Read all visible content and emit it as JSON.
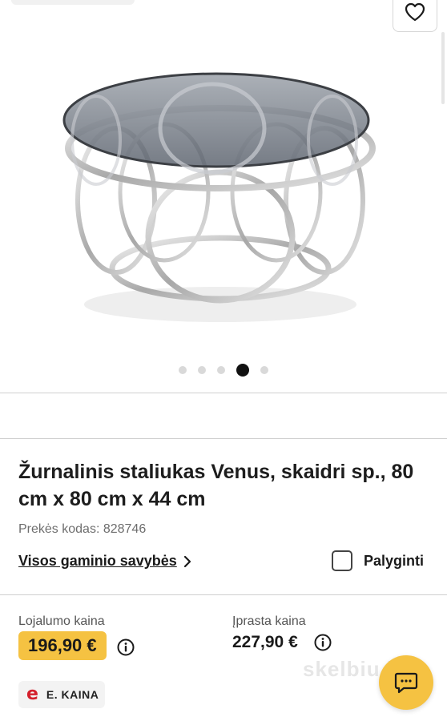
{
  "gallery": {
    "image_alt": "Žurnalinis staliukas Venus",
    "slide_count": 5,
    "active_slide": 4,
    "favorite_icon": "heart-icon"
  },
  "product": {
    "title": "Žurnalinis staliukas Venus, skaidri sp., 80 cm x 80 cm x 44 cm",
    "code": "Prekės kodas: 828746",
    "features_link": "Visos gaminio savybės",
    "compare_label": "Palyginti"
  },
  "pricing": {
    "loyalty_label": "Lojalumo kaina",
    "loyalty_price": "196,90 €",
    "regular_label": "Įprasta kaina",
    "regular_price": "227,90 €",
    "ekaina_logo": "e",
    "ekaina_label": "E. KAINA",
    "accent_color": "#f5c242"
  },
  "watermark": "skelbiu.lt",
  "chat_icon": "chat-icon"
}
